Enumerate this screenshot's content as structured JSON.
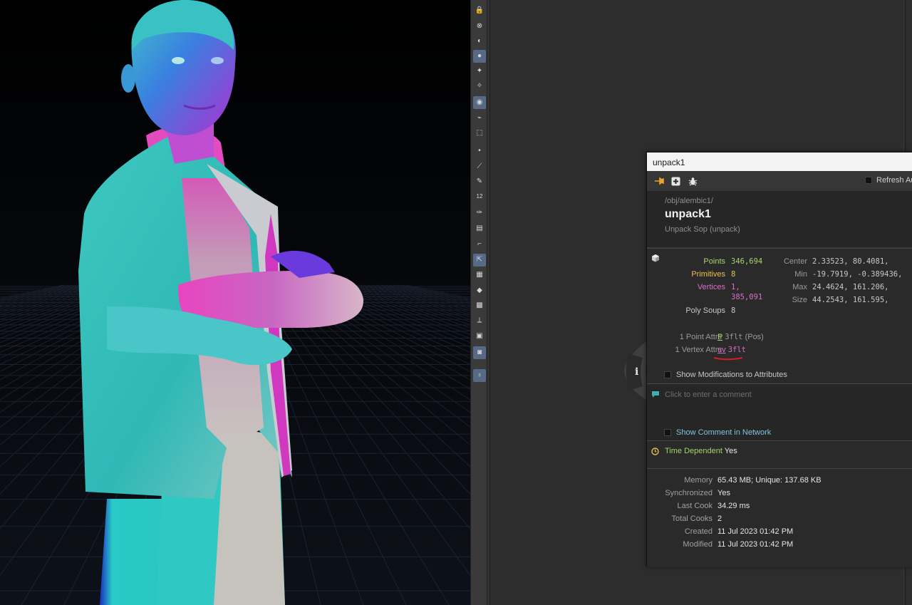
{
  "colors": {
    "points": "#a6d46a",
    "primitives": "#e6c24a",
    "vertices": "#d86fc8",
    "comment_icon": "#3fb0b0",
    "time_icon": "#e6c24a",
    "time_label": "#a6d46a",
    "annotation_underline": "#d42020"
  },
  "shelf": {
    "tools": [
      "lock-icon",
      "display-options-icon",
      "viewport-shading-icon",
      "select-icon",
      "light-icon",
      "light-handle-icon",
      "camera-view-icon",
      "snapping-icon",
      "object-transform-icon",
      "point-icon",
      "edge-icon",
      "pen-icon",
      "number-icon",
      "brush-icon",
      "paint-icon",
      "corner-icon",
      "select-tool-icon",
      "grid-icon",
      "tag-icon",
      "map-icon",
      "measure-icon",
      "box-icon",
      "camera-icon",
      "bulb-icon"
    ],
    "number_label": "12"
  },
  "info": {
    "window_title": "unpack1",
    "refresh_label": "Refresh Au",
    "path": "/obj/alembic1/",
    "node_name": "unpack1",
    "node_type": "Unpack Sop (unpack)",
    "counts": {
      "points_label": "Points",
      "points_value": "346,694",
      "primitives_label": "Primitives",
      "primitives_value": "8",
      "vertices_label": "Vertices",
      "vertices_value_line1": "1,",
      "vertices_value_line2": "385,091",
      "polysoups_label": "Poly Soups",
      "polysoups_value": "8"
    },
    "bounds": {
      "center_label": "Center",
      "center_value": "2.33523,   80.4081,",
      "min_label": "Min",
      "min_value": "-19.7919, -0.389436,",
      "max_label": "Max",
      "max_value": "24.4624,   161.206,",
      "size_label": "Size",
      "size_value": "44.2543,   161.595,"
    },
    "attrs": {
      "point_label": "1 Point Attrs",
      "point_name": "P",
      "point_type": "3flt",
      "point_extra": "(Pos)",
      "vertex_label": "1 Vertex Attrs",
      "vertex_name": "uv",
      "vertex_type": "3flt"
    },
    "show_mods_label": "Show Modifications to Attributes",
    "comment_placeholder": "Click to enter a comment",
    "show_comment_label": "Show Comment in Network",
    "time_dependent_label": "Time Dependent",
    "time_dependent_value": "Yes",
    "stats": [
      {
        "label": "Memory",
        "value": "65.43 MB; Unique: 137.68 KB"
      },
      {
        "label": "Synchronized",
        "value": "Yes"
      },
      {
        "label": "Last Cook",
        "value": "34.29 ms"
      },
      {
        "label": "Total Cooks",
        "value": "2"
      },
      {
        "label": "Created",
        "value": "11 Jul 2023 01:42 PM"
      },
      {
        "label": "Modified",
        "value": "11 Jul 2023 01:42 PM"
      }
    ]
  },
  "radial_menu": {
    "info_glyph": "i"
  }
}
